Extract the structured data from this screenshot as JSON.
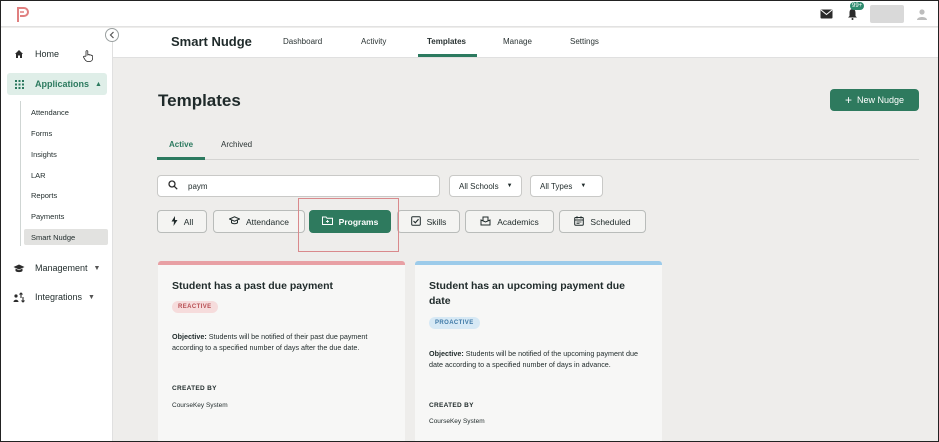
{
  "header": {
    "notification_count": "99+"
  },
  "sidebar": {
    "home": "Home",
    "applications": "Applications",
    "sub_items": [
      "Attendance",
      "Forms",
      "Insights",
      "LAR",
      "Reports",
      "Payments",
      "Smart Nudge"
    ],
    "management": "Management",
    "integrations": "Integrations"
  },
  "app": {
    "title": "Smart Nudge",
    "tabs": [
      "Dashboard",
      "Activity",
      "Templates",
      "Manage",
      "Settings"
    ],
    "active_tab": "Templates"
  },
  "main": {
    "page_title": "Templates",
    "new_button": "New Nudge",
    "sub_tabs": [
      "Active",
      "Archived"
    ],
    "search_value": "paym",
    "school_filter": "All Schools",
    "type_filter": "All Types",
    "chips": [
      "All",
      "Attendance",
      "Programs",
      "Skills",
      "Academics",
      "Scheduled"
    ],
    "active_chip": "Programs"
  },
  "cards": [
    {
      "title": "Student has a past due payment",
      "tag": "REACTIVE",
      "objective_label": "Objective:",
      "objective": "Students will be notified of their past due payment according to a specified number of days after the due date.",
      "created_by_label": "CREATED BY",
      "created_by": "CourseKey System"
    },
    {
      "title": "Student has an upcoming payment due date",
      "tag": "PROACTIVE",
      "objective_label": "Objective:",
      "objective": "Students will be notified of the upcoming payment due date according to a specified number of days in advance.",
      "created_by_label": "CREATED BY",
      "created_by": "CourseKey System"
    }
  ],
  "colors": {
    "brand": "#2e7a5e",
    "reactive": "#e8a0a4",
    "proactive": "#9ccbea",
    "highlight": "#d9898c"
  }
}
